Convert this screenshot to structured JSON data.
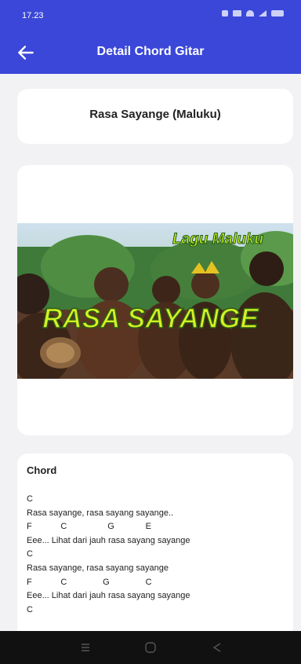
{
  "status_bar": {
    "time": "17.23"
  },
  "app_bar": {
    "title": "Detail Chord Gitar"
  },
  "song": {
    "title": "Rasa Sayange (Maluku)"
  },
  "thumbnail": {
    "overlay_top": "Lagu Maluku",
    "overlay_main": "RASA SAYANGE"
  },
  "chord": {
    "heading": "Chord",
    "lines": [
      "C",
      "Rasa sayange, rasa sayang sayange..",
      "F            C                 G             E",
      "Eee... Lihat dari jauh rasa sayang sayange",
      "C",
      "Rasa sayange, rasa sayang sayange",
      "F            C               G               C",
      "Eee... Lihat dari jauh rasa sayang sayange",
      "C"
    ]
  },
  "colors": {
    "primary": "#3a47d8",
    "background": "#f2f2f4",
    "card": "#ffffff"
  }
}
